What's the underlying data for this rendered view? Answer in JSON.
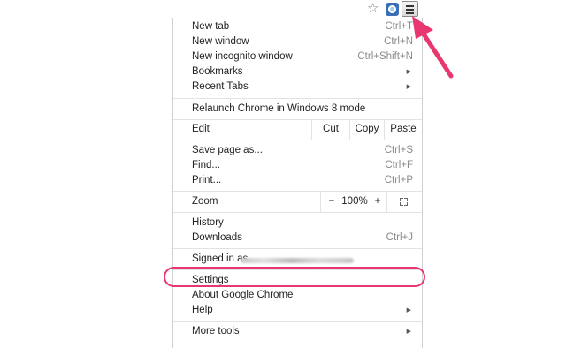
{
  "toolbar": {
    "star_icon": "star-icon",
    "extension_icon": "extension-icon",
    "menu_icon": "hamburger-menu-icon"
  },
  "menu": {
    "new_tab": {
      "label": "New tab",
      "shortcut": "Ctrl+T"
    },
    "new_window": {
      "label": "New window",
      "shortcut": "Ctrl+N"
    },
    "new_incognito": {
      "label": "New incognito window",
      "shortcut": "Ctrl+Shift+N"
    },
    "bookmarks": {
      "label": "Bookmarks"
    },
    "recent_tabs": {
      "label": "Recent Tabs"
    },
    "relaunch": {
      "label": "Relaunch Chrome in Windows 8 mode"
    },
    "edit": {
      "label": "Edit",
      "cut": "Cut",
      "copy": "Copy",
      "paste": "Paste"
    },
    "save_page": {
      "label": "Save page as...",
      "shortcut": "Ctrl+S"
    },
    "find": {
      "label": "Find...",
      "shortcut": "Ctrl+F"
    },
    "print": {
      "label": "Print...",
      "shortcut": "Ctrl+P"
    },
    "zoom": {
      "label": "Zoom",
      "minus": "−",
      "level": "100%",
      "plus": "+"
    },
    "history": {
      "label": "History"
    },
    "downloads": {
      "label": "Downloads",
      "shortcut": "Ctrl+J"
    },
    "signed_in": {
      "label": "Signed in as"
    },
    "settings": {
      "label": "Settings"
    },
    "about": {
      "label": "About Google Chrome"
    },
    "help": {
      "label": "Help"
    },
    "more_tools": {
      "label": "More tools"
    }
  },
  "colors": {
    "highlight": "#e8366e"
  }
}
